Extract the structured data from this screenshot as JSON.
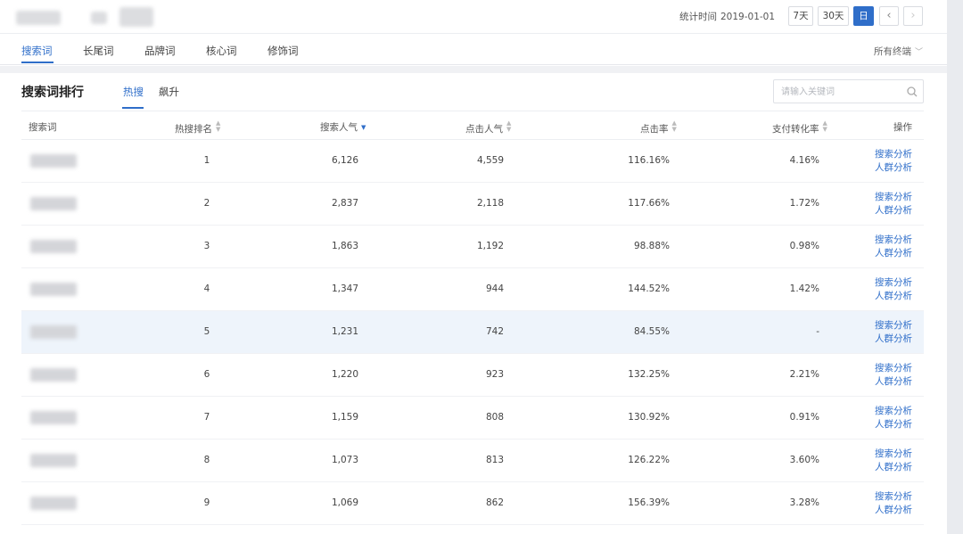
{
  "header": {
    "stat_label": "统计时间",
    "stat_date": "2019-01-01",
    "range_buttons": [
      "7天",
      "30天",
      "日"
    ],
    "prev_symbol": "‹",
    "next_symbol": "›"
  },
  "tabs": [
    "搜索词",
    "长尾词",
    "品牌词",
    "核心词",
    "修饰词"
  ],
  "terminal_select": "所有终端",
  "section": {
    "title": "搜索词排行",
    "subtabs": [
      "热搜",
      "飙升"
    ],
    "search_placeholder": "请输入关键词"
  },
  "table": {
    "columns": [
      "搜索词",
      "热搜排名",
      "搜索人气",
      "点击人气",
      "点击率",
      "支付转化率",
      "操作"
    ],
    "rows": [
      {
        "rank": "1",
        "search_pop": "6,126",
        "click_pop": "4,559",
        "ctr": "116.16%",
        "conv": "4.16%"
      },
      {
        "rank": "2",
        "search_pop": "2,837",
        "click_pop": "2,118",
        "ctr": "117.66%",
        "conv": "1.72%"
      },
      {
        "rank": "3",
        "search_pop": "1,863",
        "click_pop": "1,192",
        "ctr": "98.88%",
        "conv": "0.98%"
      },
      {
        "rank": "4",
        "search_pop": "1,347",
        "click_pop": "944",
        "ctr": "144.52%",
        "conv": "1.42%"
      },
      {
        "rank": "5",
        "search_pop": "1,231",
        "click_pop": "742",
        "ctr": "84.55%",
        "conv": "-"
      },
      {
        "rank": "6",
        "search_pop": "1,220",
        "click_pop": "923",
        "ctr": "132.25%",
        "conv": "2.21%"
      },
      {
        "rank": "7",
        "search_pop": "1,159",
        "click_pop": "808",
        "ctr": "130.92%",
        "conv": "0.91%"
      },
      {
        "rank": "8",
        "search_pop": "1,073",
        "click_pop": "813",
        "ctr": "126.22%",
        "conv": "3.60%"
      },
      {
        "rank": "9",
        "search_pop": "1,069",
        "click_pop": "862",
        "ctr": "156.39%",
        "conv": "3.28%"
      }
    ],
    "op_search_analysis": "搜索分析",
    "op_crowd_analysis": "人群分析"
  },
  "colors": {
    "accent": "#2f6ec9",
    "highlight_row": "#eef4fb"
  }
}
